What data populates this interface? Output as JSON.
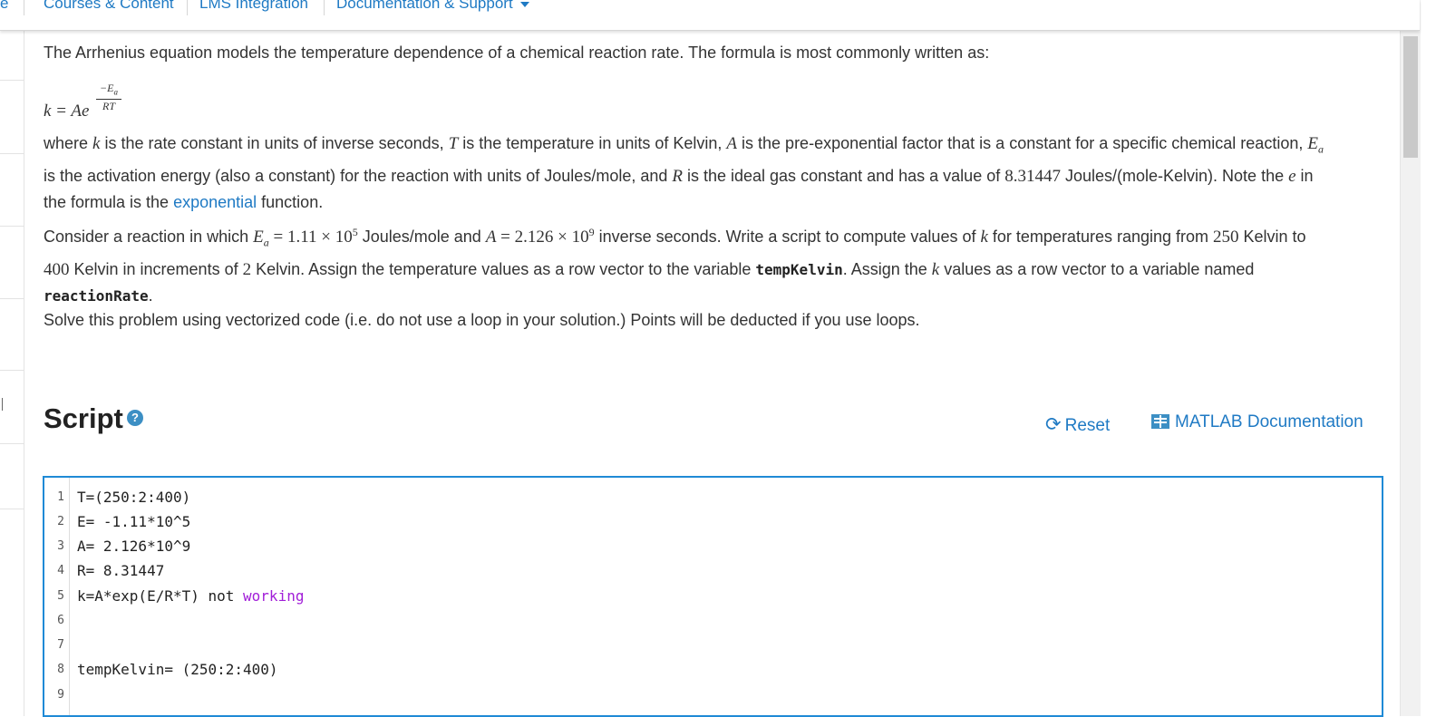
{
  "nav": {
    "edge_char": "e",
    "items": [
      {
        "label": "Courses & Content"
      },
      {
        "label": "LMS Integration"
      },
      {
        "label": "Documentation & Support"
      }
    ]
  },
  "content": {
    "intro": "The Arrhenius equation models the temperature dependence of a chemical reaction rate. The formula is most commonly written as:",
    "formula": {
      "lhs": "k = Ae",
      "exp_num": "−E",
      "exp_sub": "a",
      "exp_den": "RT"
    },
    "where": {
      "t1": "where ",
      "k": "k",
      "t2": " is the rate constant in units of inverse seconds, ",
      "T": "T",
      "t3": " is the temperature in units of Kelvin, ",
      "A": "A",
      "t4": " is the pre-exponential factor that is a constant for a specific chemical reaction, ",
      "Ea": "E",
      "Ea_sub": "a",
      "t5": " is the activation energy (also a constant) for the reaction with units of Joules/mole, and ",
      "R": "R",
      "t6": " is the ideal gas constant and has a value of ",
      "Rval": "8.31447",
      "t7": " Joules/(mole-Kelvin).  Note the ",
      "e": "e",
      "t8": " in the formula is the ",
      "link": "exponential",
      "t9": " function."
    },
    "consider": {
      "t1": "Consider a reaction in which ",
      "Ea": "E",
      "Ea_sub": "a",
      "eq1": " = 1.11 × 10",
      "eq1_sup": "5",
      "t2": " Joules/mole and ",
      "A": "A",
      "eq2": " = 2.126 × 10",
      "eq2_sup": "9",
      "t3": " inverse seconds.  Write a script to compute values of ",
      "k": "k",
      "t4": " for temperatures ranging from ",
      "n250": "250",
      "t5": " Kelvin to ",
      "n400": "400",
      "t6": " Kelvin in increments of ",
      "n2": "2",
      "t7": " Kelvin.  Assign the temperature values as a row vector to the variable ",
      "var1": "tempKelvin",
      "t8": ".  Assign the ",
      "k2": "k",
      "t9": " values as a row vector to a variable named ",
      "var2": "reactionRate",
      "t10": "."
    },
    "solve": "Solve this problem using vectorized code (i.e. do not use a loop in your solution.) Points will be deducted if you use loops."
  },
  "script": {
    "title": "Script",
    "help_glyph": "?",
    "reset_label": "Reset",
    "reset_glyph": "⟳",
    "doc_label": "MATLAB Documentation"
  },
  "editor": {
    "lines": [
      {
        "num": "1",
        "code": "T=(250:2:400)",
        "kw": ""
      },
      {
        "num": "2",
        "code": "E= -1.11*10^5",
        "kw": ""
      },
      {
        "num": "3",
        "code": "A= 2.126*10^9",
        "kw": ""
      },
      {
        "num": "4",
        "code": "R= 8.31447",
        "kw": ""
      },
      {
        "num": "5",
        "code": "k=A*exp(E/R*T) not ",
        "kw": "working"
      },
      {
        "num": "6",
        "code": "",
        "kw": ""
      },
      {
        "num": "7",
        "code": "",
        "kw": ""
      },
      {
        "num": "8",
        "code": "tempKelvin= (250:2:400)",
        "kw": ""
      },
      {
        "num": "9",
        "code": "",
        "kw": ""
      }
    ]
  }
}
